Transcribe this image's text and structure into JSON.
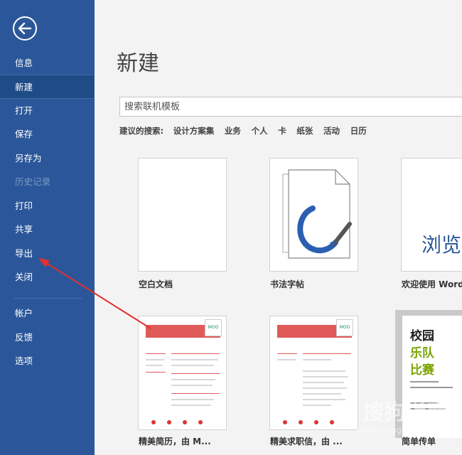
{
  "sidebar": {
    "back_icon": "back-arrow-icon",
    "items": [
      {
        "label": "信息"
      },
      {
        "label": "新建"
      },
      {
        "label": "打开"
      },
      {
        "label": "保存"
      },
      {
        "label": "另存为"
      },
      {
        "label": "历史记录"
      },
      {
        "label": "打印"
      },
      {
        "label": "共享"
      },
      {
        "label": "导出"
      },
      {
        "label": "关闭"
      },
      {
        "label": "帐户"
      },
      {
        "label": "反馈"
      },
      {
        "label": "选项"
      }
    ],
    "active": "新建",
    "disabled": "历史记录",
    "color": "#2b579a"
  },
  "main": {
    "title": "新建",
    "search": {
      "placeholder": "搜索联机模板"
    },
    "suggested": {
      "label": "建议的搜索:",
      "tags": [
        "设计方案集",
        "业务",
        "个人",
        "卡",
        "纸张",
        "活动",
        "日历"
      ]
    },
    "templates": [
      {
        "label": "空白文档"
      },
      {
        "label": "书法字帖"
      },
      {
        "label": "欢迎使用 Word",
        "preview_text": "浏览"
      },
      {
        "label": "精美简历，由 M...",
        "logo": "MOO"
      },
      {
        "label": "精美求职信，由 ...",
        "logo": "MOO"
      },
      {
        "label": "简单传单",
        "lines": [
          "校园",
          "乐队",
          "比赛"
        ]
      }
    ]
  },
  "watermark": {
    "text": "搜狗指南",
    "url": "zhinan.sogou.com"
  },
  "accent_red": "#e05a5a"
}
